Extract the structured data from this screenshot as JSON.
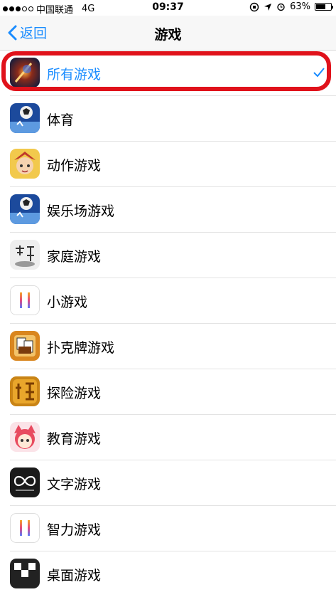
{
  "status": {
    "carrier": "中国联通",
    "network": "4G",
    "time": "09:37",
    "battery": "63%",
    "battery_level": 0.63
  },
  "nav": {
    "back_label": "返回",
    "title": "游戏"
  },
  "items": [
    {
      "label": "所有游戏",
      "selected": true
    },
    {
      "label": "体育"
    },
    {
      "label": "动作游戏"
    },
    {
      "label": "娱乐场游戏"
    },
    {
      "label": "家庭游戏"
    },
    {
      "label": "小游戏"
    },
    {
      "label": "扑克牌游戏"
    },
    {
      "label": "探险游戏"
    },
    {
      "label": "教育游戏"
    },
    {
      "label": "文字游戏"
    },
    {
      "label": "智力游戏"
    },
    {
      "label": "桌面游戏"
    }
  ],
  "colors": {
    "accent": "#1a8cff",
    "annotation": "#e0121b"
  }
}
